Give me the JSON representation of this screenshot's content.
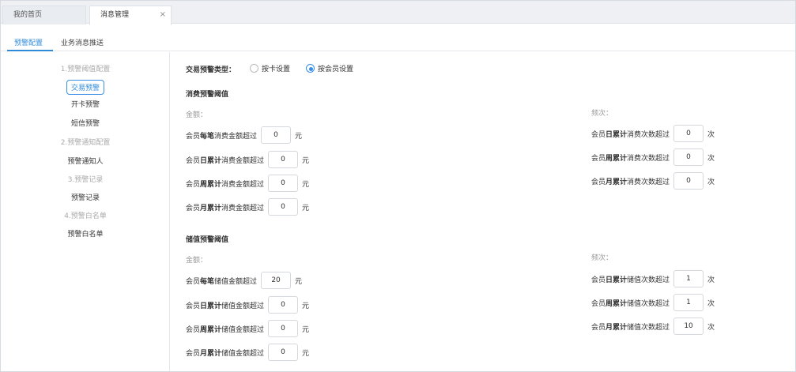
{
  "tabs": [
    {
      "label": "我的首页"
    },
    {
      "label": "消息管理",
      "close": "×"
    }
  ],
  "subtabs": [
    {
      "label": "预警配置"
    },
    {
      "label": "业务消息推送"
    }
  ],
  "sidebar": [
    {
      "label": "1.预警阈值配置"
    },
    {
      "label": "交易预警"
    },
    {
      "label": "开卡预警"
    },
    {
      "label": "短信预警"
    },
    {
      "label": "2.预警通知配置"
    },
    {
      "label": "预警通知人"
    },
    {
      "label": "3.预警记录"
    },
    {
      "label": "预警记录"
    },
    {
      "label": "4.预警白名单"
    },
    {
      "label": "预警白名单"
    }
  ],
  "main": {
    "type_label": "交易预警类型：",
    "options": [
      "按卡设置",
      "按会员设置"
    ],
    "selected_option": "按会员设置",
    "consume": {
      "title": "消费预警阈值",
      "amount_header": "金额：",
      "count_header": "频次：",
      "amount_rows": [
        {
          "prefix": "会员",
          "bold": "每笔",
          "suffix": "消费金额超过",
          "value": "0",
          "unit": "元"
        },
        {
          "prefix": "会员",
          "bold": "日累计",
          "suffix": "消费金额超过",
          "value": "0",
          "unit": "元"
        },
        {
          "prefix": "会员",
          "bold": "周累计",
          "suffix": "消费金额超过",
          "value": "0",
          "unit": "元"
        },
        {
          "prefix": "会员",
          "bold": "月累计",
          "suffix": "消费金额超过",
          "value": "0",
          "unit": "元"
        }
      ],
      "count_rows": [
        {
          "prefix": "会员",
          "bold": "日累计",
          "suffix": "消费次数超过",
          "value": "0",
          "unit": "次"
        },
        {
          "prefix": "会员",
          "bold": "周累计",
          "suffix": "消费次数超过",
          "value": "0",
          "unit": "次"
        },
        {
          "prefix": "会员",
          "bold": "月累计",
          "suffix": "消费次数超过",
          "value": "0",
          "unit": "次"
        }
      ]
    },
    "stored": {
      "title": "储值预警阈值",
      "amount_header": "金额：",
      "count_header": "频次：",
      "amount_rows": [
        {
          "prefix": "会员",
          "bold": "每笔",
          "suffix": "储值金额超过",
          "value": "20",
          "unit": "元"
        },
        {
          "prefix": "会员",
          "bold": "日累计",
          "suffix": "储值金额超过",
          "value": "0",
          "unit": "元"
        },
        {
          "prefix": "会员",
          "bold": "周累计",
          "suffix": "储值金额超过",
          "value": "0",
          "unit": "元"
        },
        {
          "prefix": "会员",
          "bold": "月累计",
          "suffix": "储值金额超过",
          "value": "0",
          "unit": "元"
        }
      ],
      "count_rows": [
        {
          "prefix": "会员",
          "bold": "日累计",
          "suffix": "储值次数超过",
          "value": "1",
          "unit": "次"
        },
        {
          "prefix": "会员",
          "bold": "周累计",
          "suffix": "储值次数超过",
          "value": "1",
          "unit": "次"
        },
        {
          "prefix": "会员",
          "bold": "月累计",
          "suffix": "储值次数超过",
          "value": "10",
          "unit": "次"
        }
      ]
    }
  },
  "colors": {
    "accent": "#2f8bd8",
    "border": "#d6dbe2",
    "tabbar": "#eef0f4"
  }
}
